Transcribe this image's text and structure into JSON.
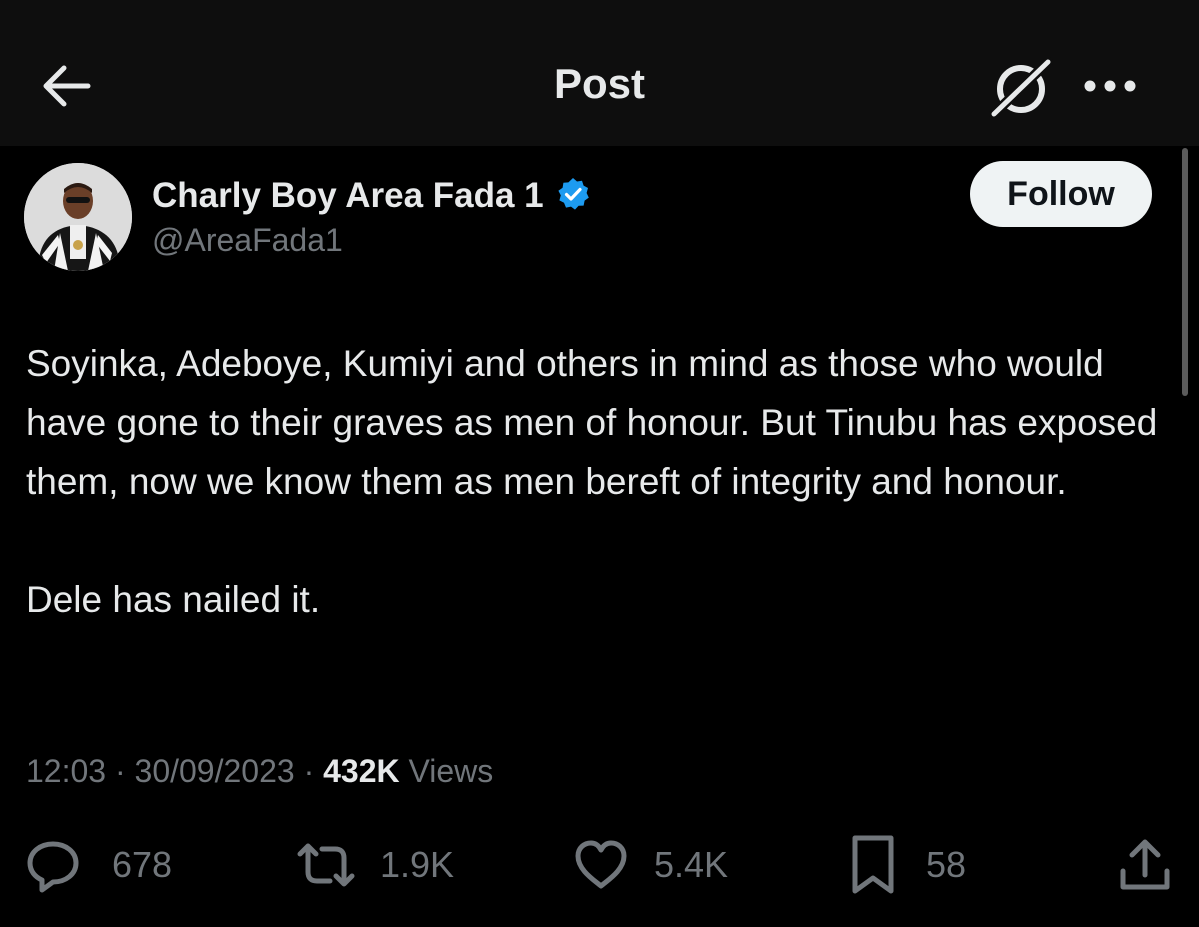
{
  "header": {
    "title": "Post",
    "back_icon": "arrow-left-icon",
    "grok_icon": "grok-icon",
    "more_icon": "more-horizontal-icon"
  },
  "author": {
    "display_name": "Charly Boy Area Fada 1",
    "handle": "@AreaFada1",
    "verified_color": "#1d9bf0",
    "follow_label": "Follow"
  },
  "post": {
    "paragraphs": [
      "Soyinka, Adeboye, Kumiyi and others in mind as those who would have gone to their graves as men of honour. But Tinubu has exposed them,  now we know them as men bereft of integrity and honour.",
      "Dele has nailed it."
    ],
    "time": "12:03",
    "date": "30/09/2023",
    "views_count": "432K",
    "views_label": "Views"
  },
  "actions": {
    "replies": "678",
    "reposts": "1.9K",
    "likes": "5.4K",
    "bookmarks": "58"
  },
  "colors": {
    "background": "#000000",
    "header_background": "#0e0e0e",
    "text": "#e7e9ea",
    "secondary_text": "#71767b",
    "accent": "#1d9bf0"
  }
}
